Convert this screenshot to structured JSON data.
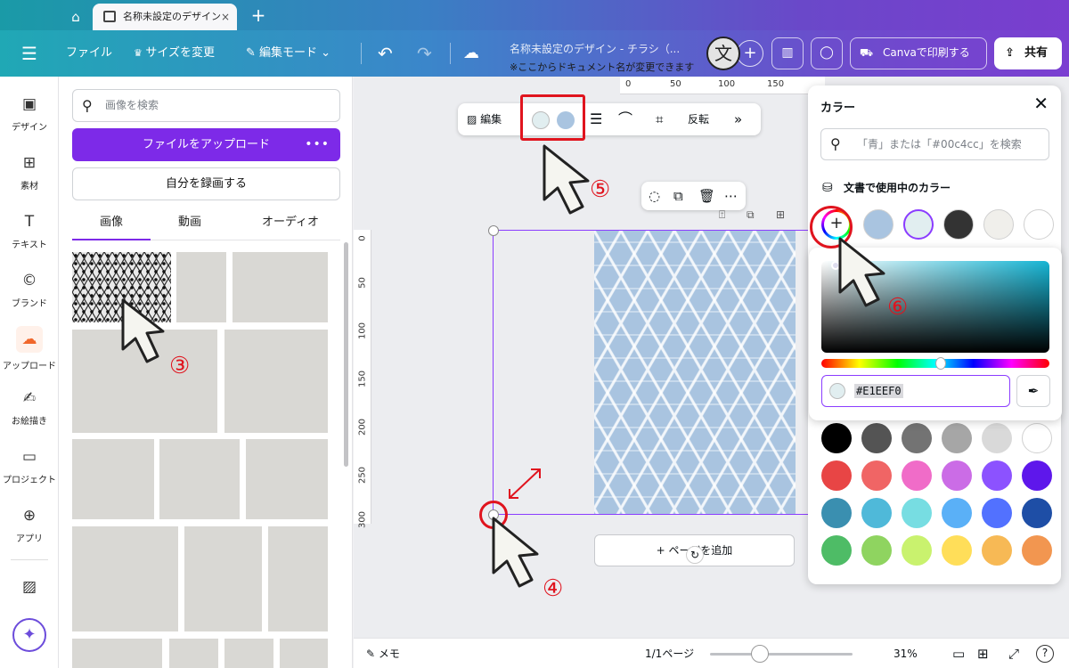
{
  "browser": {
    "home_icon": "home-icon",
    "tab_title": "名称未設定のデザイン",
    "tab_close": "×",
    "new_tab": "+"
  },
  "header": {
    "menu_icon": "hamburger-icon",
    "file": "ファイル",
    "resize": "サイズを変更",
    "edit_mode": "編集モード",
    "doc_title": "名称未設定のデザイン - チラシ（...",
    "doc_note": "※ここからドキュメント名が変更できます",
    "lang_char": "文",
    "plus": "+",
    "print": "Canvaで印刷する",
    "share": "共有"
  },
  "rail": {
    "items": [
      {
        "label": "デザイン",
        "icon": "layout-icon"
      },
      {
        "label": "素材",
        "icon": "elements-icon"
      },
      {
        "label": "テキスト",
        "icon": "text-icon"
      },
      {
        "label": "ブランド",
        "icon": "brand-icon"
      },
      {
        "label": "アップロード",
        "icon": "upload-cloud-icon"
      },
      {
        "label": "お絵描き",
        "icon": "draw-icon"
      },
      {
        "label": "プロジェクト",
        "icon": "folder-icon"
      },
      {
        "label": "アプリ",
        "icon": "apps-icon"
      }
    ]
  },
  "panel": {
    "search_placeholder": "画像を検索",
    "upload_label": "ファイルをアップロード",
    "upload_more": "•••",
    "record_label": "自分を録画する",
    "tabs": [
      "画像",
      "動画",
      "オーディオ"
    ]
  },
  "context_toolbar": {
    "edit": "編集",
    "flip": "反転",
    "swatch_colors": [
      "#e1eef0",
      "#a9c4e0"
    ]
  },
  "canvas": {
    "ruler_top": [
      "0",
      "50",
      "100",
      "150"
    ],
    "ruler_left": [
      "0",
      "50",
      "100",
      "150",
      "200",
      "250",
      "300"
    ],
    "add_page": "+ ページを追加"
  },
  "bottom": {
    "notes": "メモ",
    "pages": "1/1ページ",
    "zoom_pct": 31,
    "zoom": "31%",
    "help": "?"
  },
  "color_panel": {
    "title": "カラー",
    "search_placeholder": "「青」または「#00c4cc」を検索",
    "section": "文書で使用中のカラー",
    "doc_colors": [
      "#a9c4e0",
      "#e1eef0",
      "#333333",
      "#f0efeb",
      "#ffffff"
    ],
    "hex_value": "#E1EEF0",
    "default_colors": [
      "#000000",
      "#545454",
      "#737373",
      "#a6a6a6",
      "#d9d9d9",
      "#ffffff",
      "#e84545",
      "#f06565",
      "#f06cc8",
      "#cb6ce6",
      "#8c52ff",
      "#5e17eb",
      "#3a8fb0",
      "#4fb9d9",
      "#77dde2",
      "#5ab0f7",
      "#5271ff",
      "#1e4ea6",
      "#4ebc66",
      "#8fd460",
      "#c9f26e",
      "#ffde59",
      "#f7b955",
      "#f29650"
    ]
  },
  "annotations": {
    "n3": "③",
    "n4": "④",
    "n5": "⑤",
    "n6": "⑥"
  }
}
